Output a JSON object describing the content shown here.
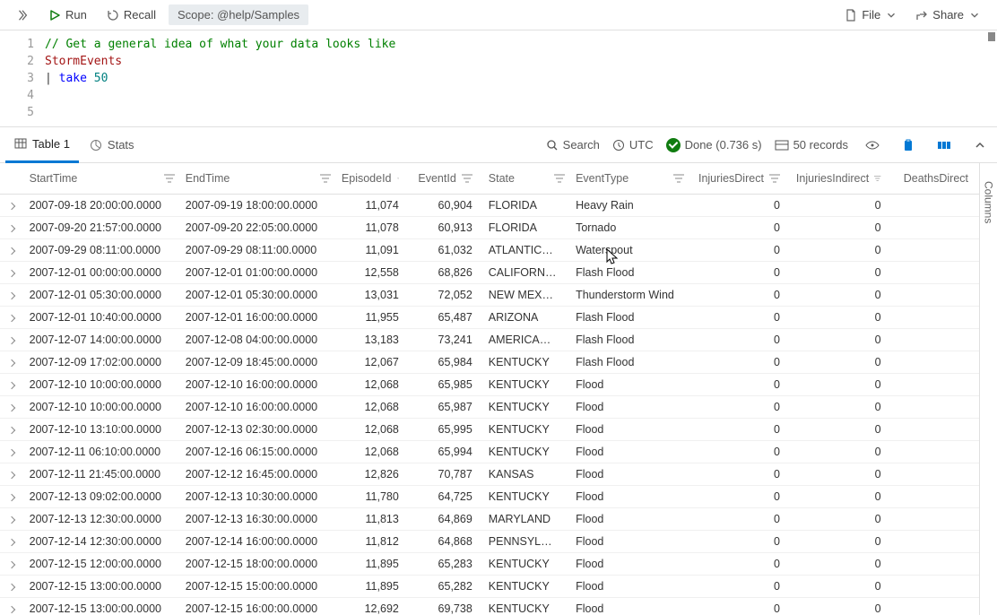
{
  "toolbar": {
    "run": "Run",
    "recall": "Recall",
    "scope_label": "Scope:",
    "scope_value": "@help/Samples",
    "file": "File",
    "share": "Share"
  },
  "editor": {
    "lines": [
      {
        "n": "1",
        "comment": "// Get a general idea of what your data looks like"
      },
      {
        "n": "2",
        "ident": "StormEvents"
      },
      {
        "n": "3",
        "pipe": "| ",
        "op": "take ",
        "num": "50"
      },
      {
        "n": "4"
      },
      {
        "n": "5"
      }
    ]
  },
  "resultbar": {
    "table_tab": "Table 1",
    "stats_tab": "Stats",
    "search": "Search",
    "utc": "UTC",
    "done": "Done (0.736 s)",
    "records": "50 records",
    "columns_side": "Columns"
  },
  "columns": {
    "start": "StartTime",
    "end": "EndTime",
    "episode": "EpisodeId",
    "event": "EventId",
    "state": "State",
    "etype": "EventType",
    "injd": "InjuriesDirect",
    "inji": "InjuriesIndirect",
    "dd": "DeathsDirect"
  },
  "rows": [
    {
      "start": "2007-09-18 20:00:00.0000",
      "end": "2007-09-19 18:00:00.0000",
      "ep": "11,074",
      "ev": "60,904",
      "state": "FLORIDA",
      "etype": "Heavy Rain",
      "injd": "0",
      "inji": "0"
    },
    {
      "start": "2007-09-20 21:57:00.0000",
      "end": "2007-09-20 22:05:00.0000",
      "ep": "11,078",
      "ev": "60,913",
      "state": "FLORIDA",
      "etype": "Tornado",
      "injd": "0",
      "inji": "0"
    },
    {
      "start": "2007-09-29 08:11:00.0000",
      "end": "2007-09-29 08:11:00.0000",
      "ep": "11,091",
      "ev": "61,032",
      "state": "ATLANTIC…",
      "etype": "Waterspout",
      "injd": "0",
      "inji": "0"
    },
    {
      "start": "2007-12-01 00:00:00.0000",
      "end": "2007-12-01 01:00:00.0000",
      "ep": "12,558",
      "ev": "68,826",
      "state": "CALIFORN…",
      "etype": "Flash Flood",
      "injd": "0",
      "inji": "0"
    },
    {
      "start": "2007-12-01 05:30:00.0000",
      "end": "2007-12-01 05:30:00.0000",
      "ep": "13,031",
      "ev": "72,052",
      "state": "NEW MEX…",
      "etype": "Thunderstorm Wind",
      "injd": "0",
      "inji": "0"
    },
    {
      "start": "2007-12-01 10:40:00.0000",
      "end": "2007-12-01 16:00:00.0000",
      "ep": "11,955",
      "ev": "65,487",
      "state": "ARIZONA",
      "etype": "Flash Flood",
      "injd": "0",
      "inji": "0"
    },
    {
      "start": "2007-12-07 14:00:00.0000",
      "end": "2007-12-08 04:00:00.0000",
      "ep": "13,183",
      "ev": "73,241",
      "state": "AMERICA…",
      "etype": "Flash Flood",
      "injd": "0",
      "inji": "0"
    },
    {
      "start": "2007-12-09 17:02:00.0000",
      "end": "2007-12-09 18:45:00.0000",
      "ep": "12,067",
      "ev": "65,984",
      "state": "KENTUCKY",
      "etype": "Flash Flood",
      "injd": "0",
      "inji": "0"
    },
    {
      "start": "2007-12-10 10:00:00.0000",
      "end": "2007-12-10 16:00:00.0000",
      "ep": "12,068",
      "ev": "65,985",
      "state": "KENTUCKY",
      "etype": "Flood",
      "injd": "0",
      "inji": "0"
    },
    {
      "start": "2007-12-10 10:00:00.0000",
      "end": "2007-12-10 16:00:00.0000",
      "ep": "12,068",
      "ev": "65,987",
      "state": "KENTUCKY",
      "etype": "Flood",
      "injd": "0",
      "inji": "0"
    },
    {
      "start": "2007-12-10 13:10:00.0000",
      "end": "2007-12-13 02:30:00.0000",
      "ep": "12,068",
      "ev": "65,995",
      "state": "KENTUCKY",
      "etype": "Flood",
      "injd": "0",
      "inji": "0"
    },
    {
      "start": "2007-12-11 06:10:00.0000",
      "end": "2007-12-16 06:15:00.0000",
      "ep": "12,068",
      "ev": "65,994",
      "state": "KENTUCKY",
      "etype": "Flood",
      "injd": "0",
      "inji": "0"
    },
    {
      "start": "2007-12-11 21:45:00.0000",
      "end": "2007-12-12 16:45:00.0000",
      "ep": "12,826",
      "ev": "70,787",
      "state": "KANSAS",
      "etype": "Flood",
      "injd": "0",
      "inji": "0"
    },
    {
      "start": "2007-12-13 09:02:00.0000",
      "end": "2007-12-13 10:30:00.0000",
      "ep": "11,780",
      "ev": "64,725",
      "state": "KENTUCKY",
      "etype": "Flood",
      "injd": "0",
      "inji": "0"
    },
    {
      "start": "2007-12-13 12:30:00.0000",
      "end": "2007-12-13 16:30:00.0000",
      "ep": "11,813",
      "ev": "64,869",
      "state": "MARYLAND",
      "etype": "Flood",
      "injd": "0",
      "inji": "0"
    },
    {
      "start": "2007-12-14 12:30:00.0000",
      "end": "2007-12-14 16:00:00.0000",
      "ep": "11,812",
      "ev": "64,868",
      "state": "PENNSYL…",
      "etype": "Flood",
      "injd": "0",
      "inji": "0"
    },
    {
      "start": "2007-12-15 12:00:00.0000",
      "end": "2007-12-15 18:00:00.0000",
      "ep": "11,895",
      "ev": "65,283",
      "state": "KENTUCKY",
      "etype": "Flood",
      "injd": "0",
      "inji": "0"
    },
    {
      "start": "2007-12-15 13:00:00.0000",
      "end": "2007-12-15 15:00:00.0000",
      "ep": "11,895",
      "ev": "65,282",
      "state": "KENTUCKY",
      "etype": "Flood",
      "injd": "0",
      "inji": "0"
    },
    {
      "start": "2007-12-15 13:00:00.0000",
      "end": "2007-12-15 16:00:00.0000",
      "ep": "12,692",
      "ev": "69,738",
      "state": "KENTUCKY",
      "etype": "Flood",
      "injd": "0",
      "inji": "0"
    }
  ]
}
